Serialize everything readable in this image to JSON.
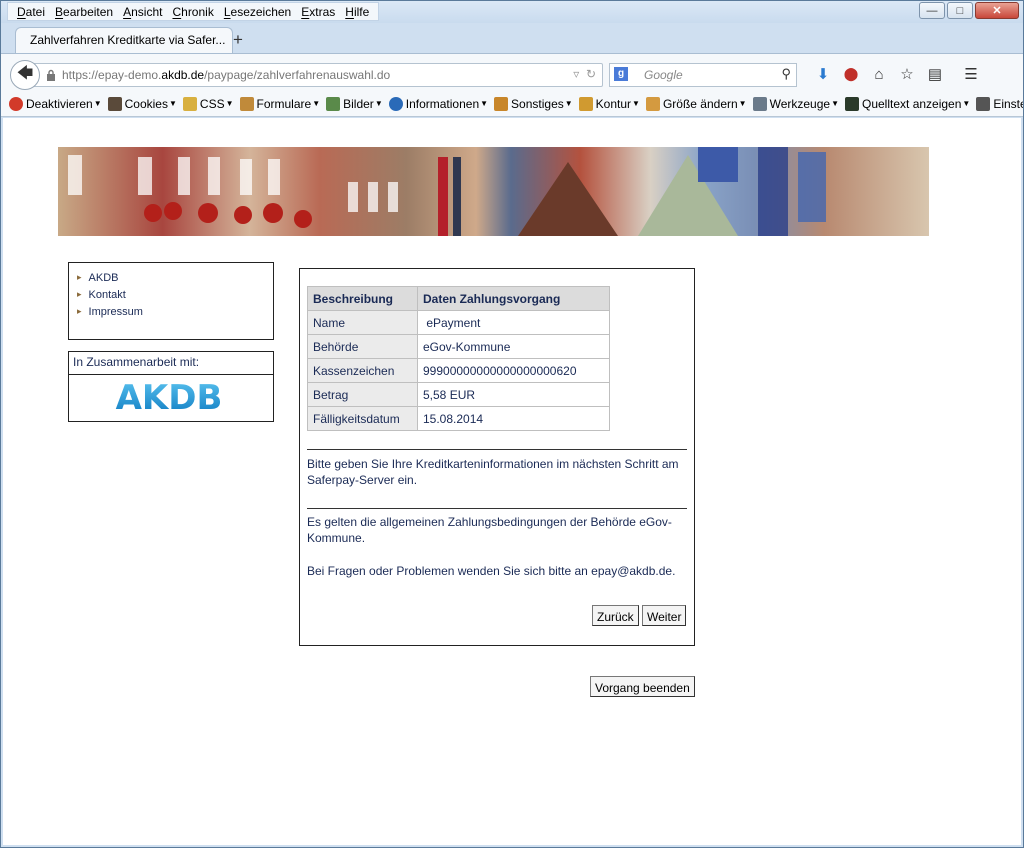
{
  "menu": [
    "Datei",
    "Bearbeiten",
    "Ansicht",
    "Chronik",
    "Lesezeichen",
    "Extras",
    "Hilfe"
  ],
  "tab": {
    "title": "Zahlverfahren Kreditkarte via Safer..."
  },
  "url": {
    "prefix": "https://epay-demo.",
    "domain": "akdb.de",
    "path": "/paypage/zahlverfahrenauswahl.do"
  },
  "search": {
    "placeholder": "Google"
  },
  "toolbar": [
    {
      "label": "Deaktivieren",
      "color": "#d23a2a"
    },
    {
      "label": "Cookies",
      "color": "#5a4a3a"
    },
    {
      "label": "CSS",
      "color": "#d8b040"
    },
    {
      "label": "Formulare",
      "color": "#c08a3a"
    },
    {
      "label": "Bilder",
      "color": "#5a8a4a"
    },
    {
      "label": "Informationen",
      "color": "#2a6ab8"
    },
    {
      "label": "Sonstiges",
      "color": "#c8862a"
    },
    {
      "label": "Kontur",
      "color": "#d09a30"
    },
    {
      "label": "Größe ändern",
      "color": "#d49a40"
    },
    {
      "label": "Werkzeuge",
      "color": "#6a7a8a"
    },
    {
      "label": "Quelltext anzeigen",
      "color": "#2a3a2a"
    },
    {
      "label": "Einstellungen",
      "color": "#555555"
    }
  ],
  "sidebar": {
    "links": [
      "AKDB",
      "Kontakt",
      "Impressum"
    ]
  },
  "partner": {
    "heading": "In Zusammenarbeit mit:",
    "logo_text": "AKDB"
  },
  "table": {
    "headers": [
      "Beschreibung",
      "Daten Zahlungsvorgang"
    ],
    "rows": [
      {
        "label": "Name",
        "value": " ePayment"
      },
      {
        "label": "Behörde",
        "value": "eGov-Kommune"
      },
      {
        "label": "Kassenzeichen",
        "value": "99900000000000000000620"
      },
      {
        "label": "Betrag",
        "value": "5,58 EUR"
      },
      {
        "label": "Fälligkeitsdatum",
        "value": "15.08.2014"
      }
    ]
  },
  "text": {
    "info1": "Bitte geben Sie Ihre Kreditkarteninformationen im nächsten Schritt am Saferpay-Server ein.",
    "info2": "Es gelten die allgemeinen Zahlungsbedingungen der Behörde eGov-Kommune.",
    "info3": "Bei Fragen oder Problemen wenden Sie sich bitte an epay@akdb.de."
  },
  "buttons": {
    "back": "Zurück",
    "next": "Weiter",
    "end": "Vorgang beenden"
  },
  "colors": {
    "text": "#1a2a55",
    "akdb_blue": "#1a8fd0"
  }
}
